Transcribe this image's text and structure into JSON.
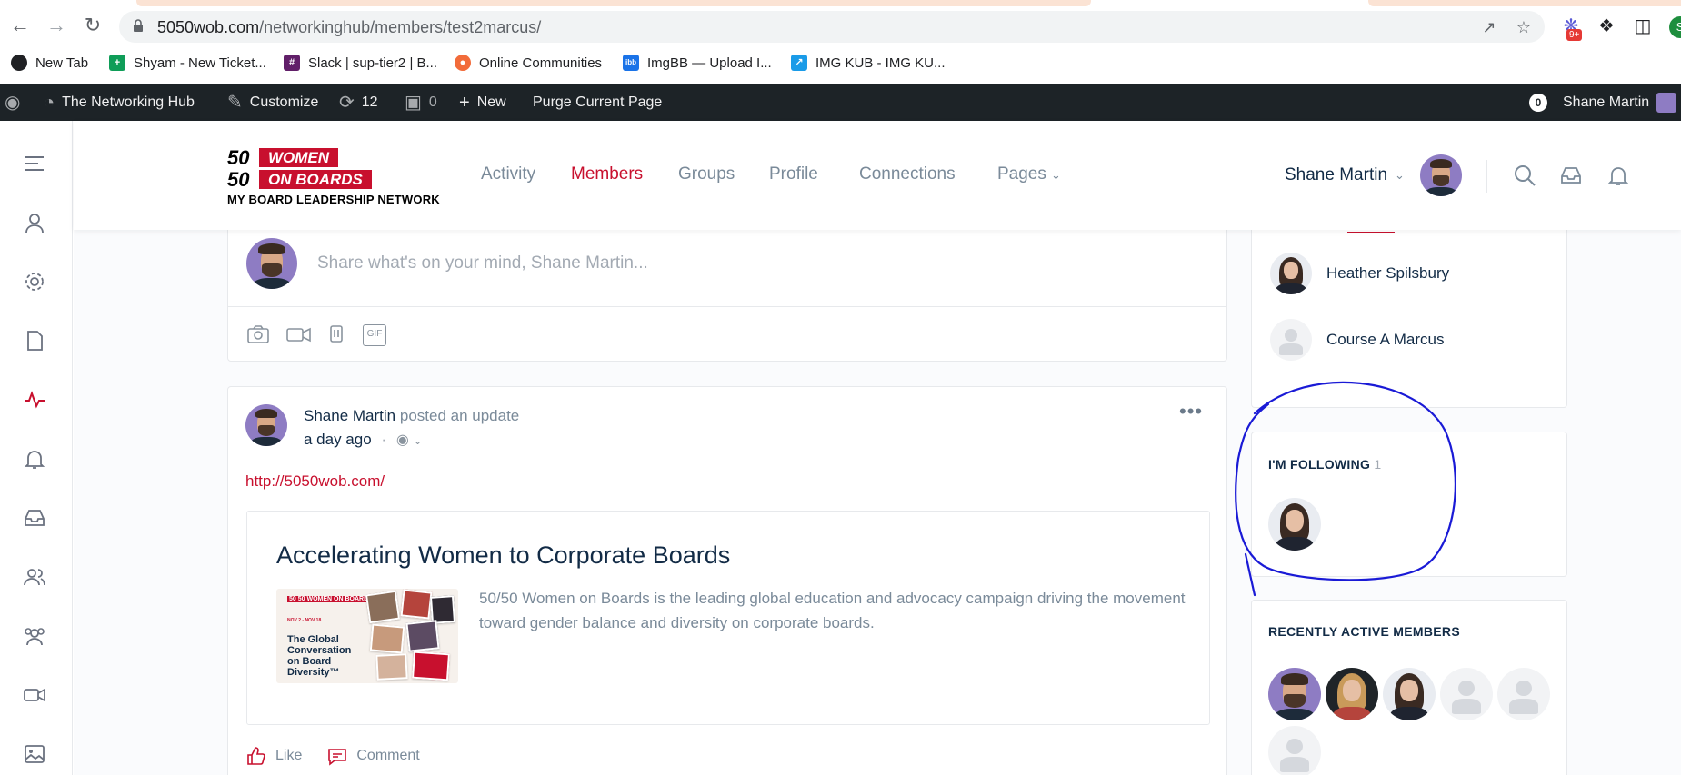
{
  "browser": {
    "url_host": "5050wob.com",
    "url_path": "/networkinghub/members/test2marcus/",
    "extension_badge": "9+",
    "profile_initial": "S",
    "bookmarks": [
      {
        "label": "New Tab",
        "icon": "globe-icon",
        "color": "#202124"
      },
      {
        "label": "Shyam - New Ticket...",
        "icon": "sheets-icon",
        "color": "#0f9d58"
      },
      {
        "label": "Slack | sup-tier2 | B...",
        "icon": "slack-icon",
        "color": "#611f69"
      },
      {
        "label": "Online Communities",
        "icon": "communities-icon",
        "color": "#f26b3a"
      },
      {
        "label": "ImgBB — Upload I...",
        "icon": "imgbb-icon",
        "color": "#1a73e8"
      },
      {
        "label": "IMG KUB - IMG KU...",
        "icon": "imgkub-icon",
        "color": "#1a9be8"
      }
    ]
  },
  "adminbar": {
    "site_name": "The Networking Hub",
    "customize": "Customize",
    "updates_count": "12",
    "comments_count": "0",
    "new_label": "New",
    "purge_label": "Purge Current Page",
    "notif_count": "0",
    "user_name": "Shane Martin"
  },
  "header": {
    "logo": {
      "line1_num": "50",
      "line1_word": "WOMEN",
      "line2_num": "50",
      "line2_word": "ON BOARDS",
      "tagline": "MY BOARD LEADERSHIP NETWORK"
    },
    "nav": [
      "Activity",
      "Members",
      "Groups",
      "Profile",
      "Connections",
      "Pages"
    ],
    "active_nav": "Members",
    "user_name": "Shane Martin"
  },
  "whats_new": {
    "placeholder": "Share what's on your mind, Shane Martin...",
    "gif_label": "GIF"
  },
  "activity": {
    "author": "Shane Martin",
    "action": "posted an update",
    "time": "a day ago",
    "link": "http://5050wob.com/",
    "preview_title": "Accelerating Women to Corporate Boards",
    "preview_desc": "50/50 Women on Boards is the leading global education and advocacy campaign driving the movement toward gender balance and diversity on corporate boards.",
    "thumb_logo": "50 50 WOMEN ON BOARDS",
    "thumb_date": "NOV 2 - NOV 18",
    "thumb_text": "The Global Conversation on Board Diversity™",
    "like_label": "Like",
    "comment_label": "Comment"
  },
  "sidebar_widgets": {
    "followers": [
      {
        "name": "Heather Spilsbury",
        "avatar": "female"
      },
      {
        "name": "Course A Marcus",
        "avatar": "blank"
      }
    ],
    "following_title": "I'M FOLLOWING",
    "following_count": "1",
    "recent_title": "RECENTLY ACTIVE MEMBERS"
  },
  "colors": {
    "brand_red": "#c8102e",
    "admin_bar": "#1d2327",
    "annotation_blue": "#1a1ad6"
  }
}
